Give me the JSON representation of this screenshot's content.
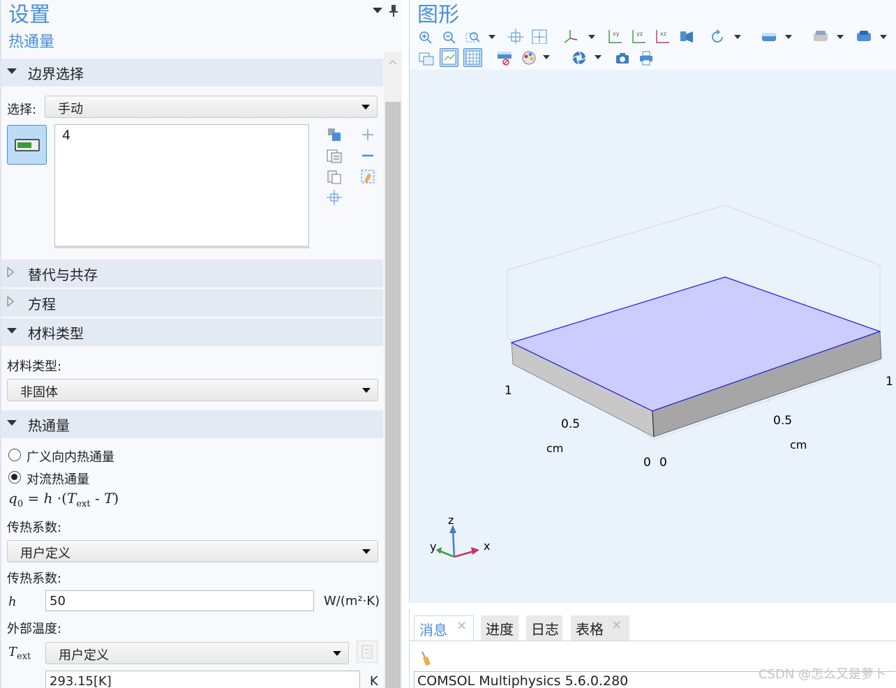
{
  "settings": {
    "title": "设置",
    "subtitle": "热通量",
    "sections": {
      "boundary": "边界选择",
      "override": "替代与共存",
      "equation": "方程",
      "material_type": "材料类型",
      "heat_flux": "热通量"
    },
    "selection": {
      "label": "选择:",
      "value": "手动",
      "items": [
        "4"
      ]
    },
    "material": {
      "label": "材料类型:",
      "value": "非固体"
    },
    "heat_flux": {
      "options": [
        "广义向内热通量",
        "对流热通量"
      ],
      "selected": "对流热通量",
      "equation": {
        "q": "q",
        "sub0": "0",
        "rhs_h": "h",
        "T": "T",
        "sub_ext": "ext",
        "T2": "T"
      },
      "coef_label": "传热系数:",
      "coef_mode": "用户定义",
      "coef_label2": "传热系数:",
      "h_symbol": "h",
      "h_value": "50",
      "h_unit": "W/(m²·K)",
      "ext_temp_label": "外部温度:",
      "text_symbol": "T",
      "text_sub": "ext",
      "text_mode": "用户定义",
      "text_value": "293.15[K]",
      "text_unit": "K"
    }
  },
  "graphics": {
    "title": "图形",
    "toolbar_icons": [
      "zoom-in-icon",
      "zoom-out-icon",
      "zoom-box-icon",
      "move-icon",
      "zoom-extents-icon",
      "axis-orientation-icon",
      "xy-view-icon",
      "yz-view-icon",
      "xz-view-icon",
      "scene-light-icon",
      "rotate-icon",
      "wireframe-icon",
      "transparency-icon",
      "render-icon",
      "select-box-icon",
      "grid-icon",
      "show-axes-icon",
      "hide-icon",
      "color-icon",
      "aperture-icon",
      "camera-icon",
      "print-icon"
    ],
    "axis_labels": {
      "left_1": "1",
      "left_05": "0.5",
      "left_unit": "cm",
      "right_1": "1",
      "right_05": "0.5",
      "right_unit": "cm",
      "origin_a": "0",
      "origin_b": "0"
    },
    "triad": {
      "x": "x",
      "y": "y",
      "z": "z"
    },
    "colors": {
      "top_face": "#ccccff",
      "edge": "#1a1ae6",
      "side_front": "#a6a6a6",
      "side_left": "#c8c8c8"
    }
  },
  "messages": {
    "tabs": [
      "消息",
      "进度",
      "日志",
      "表格"
    ],
    "active_tab": "消息",
    "text": "COMSOL Multiphysics 5.6.0.280"
  },
  "watermark": "CSDN @怎么又是萝卜"
}
